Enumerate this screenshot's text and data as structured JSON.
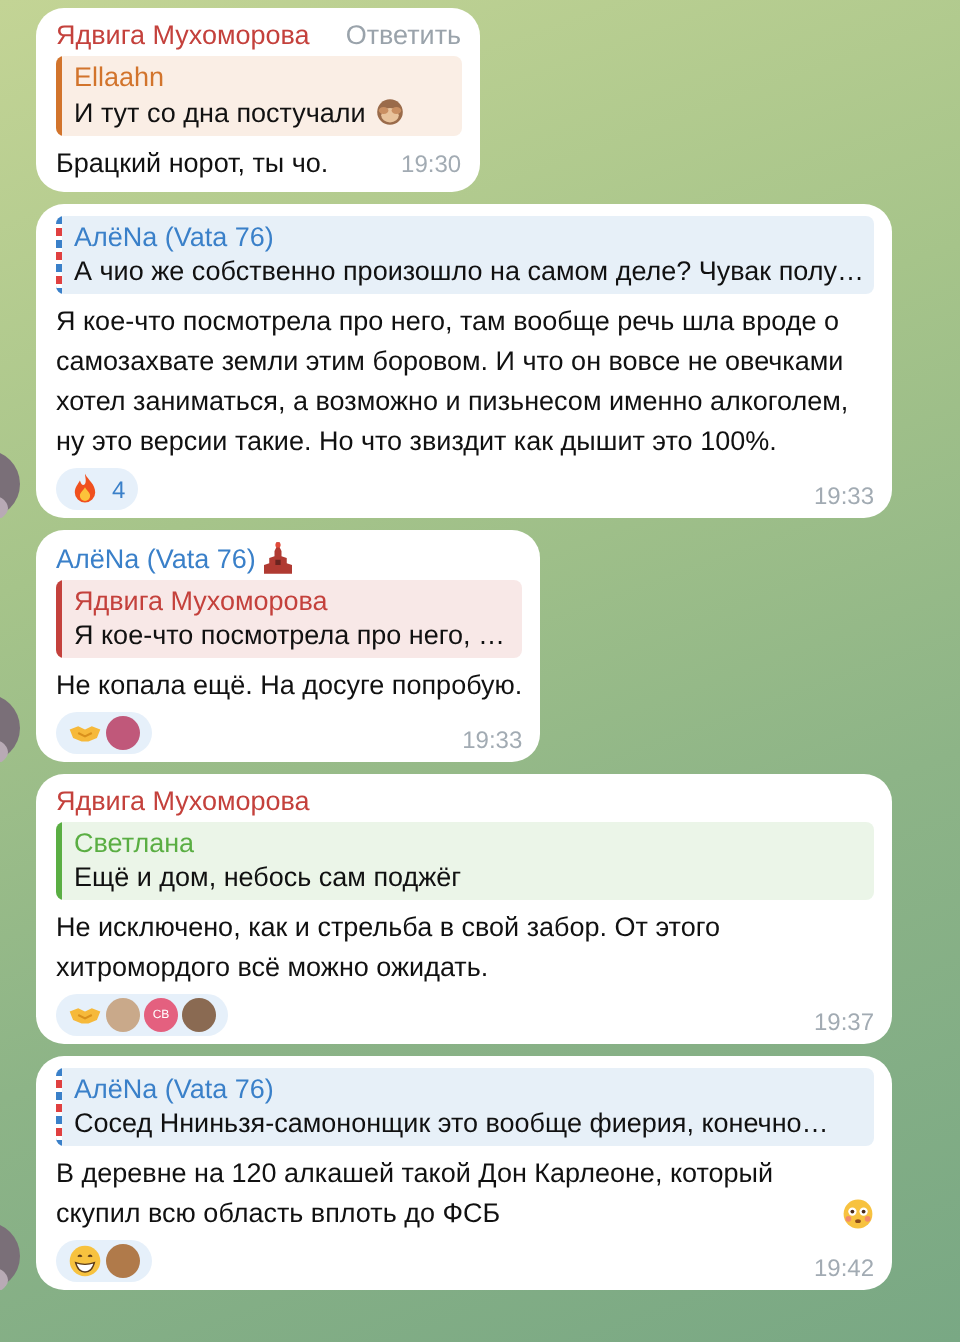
{
  "messages": [
    {
      "author": "Ядвига Мухоморова",
      "color": "#c4413c",
      "name_badge": false,
      "avatar": false,
      "reply_action": "Ответить",
      "quote": {
        "author": "Ellaahn",
        "color": "#d2742c",
        "striped": false,
        "text": "И тут со дна постучали",
        "emoji": {
          "kind": "monkey"
        }
      },
      "text": "Брацкий норот, ты чо.",
      "time": "19:30"
    },
    {
      "avatar": true,
      "name_badge": false,
      "quote": {
        "author": "АлёNa (Vata 76)",
        "color": "#3a80c9",
        "striped": true,
        "text": "А чио же собственно произошло на самом деле? Чувак полу…"
      },
      "text": "Я кое-что посмотрела про него, там вообще речь шла вроде о самозахвате земли этим боровом. И что он вовсе не овечками хотел заниматься, а возможно и пизьнесом именно алкоголем, ну это версии такие. Но что звиздит как дышит это 100%.",
      "reactions": [
        {
          "kind": "fire",
          "count": "4"
        }
      ],
      "time": "19:33"
    },
    {
      "author": "АлёNa (Vata 76)",
      "color": "#3a80c9",
      "name_badge": true,
      "avatar": true,
      "quote": {
        "author": "Ядвига Мухоморова",
        "color": "#c4413c",
        "striped": false,
        "text": "Я кое-что посмотрела про него, …"
      },
      "text": "Не копала ещё. На досуге попробую.",
      "reactions": [
        {
          "kind": "handshake"
        },
        {
          "kind": "avatar",
          "color": "#c0587a"
        }
      ],
      "time": "19:33"
    },
    {
      "author": "Ядвига Мухоморова",
      "color": "#c4413c",
      "name_badge": false,
      "avatar": false,
      "quote": {
        "author": "Светлана",
        "color": "#5aae43",
        "striped": false,
        "text": "Ещё и дом, небось сам поджёг"
      },
      "text": "Не исключено, как и стрельба в свой забор. От этого хитромордого всё можно ожидать.",
      "reactions": [
        {
          "kind": "handshake"
        },
        {
          "kind": "avatar",
          "color": "#c9a98a"
        },
        {
          "kind": "avatar",
          "color": "#e4607f",
          "initials": "СВ"
        },
        {
          "kind": "avatar",
          "color": "#8a6a52"
        }
      ],
      "time": "19:37"
    },
    {
      "avatar": true,
      "name_badge": false,
      "quote": {
        "author": "АлёNa (Vata 76)",
        "color": "#3a80c9",
        "striped": true,
        "text": "Сосед Нниньзя-самононщик это вообще фиерия, конечно…"
      },
      "text": "В деревне на 120 алкашей такой Дон Карлеоне, который скупил всю область вплоть до ФСБ",
      "emoji": {
        "kind": "flushed"
      },
      "reactions": [
        {
          "kind": "grin"
        },
        {
          "kind": "avatar",
          "color": "#b07a4a"
        }
      ],
      "time": "19:42"
    }
  ]
}
